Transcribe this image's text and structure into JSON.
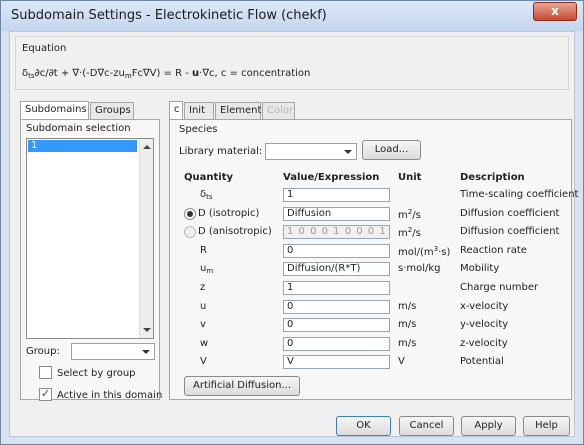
{
  "window": {
    "title": "Subdomain Settings - Electrokinetic Flow (chekf)",
    "close": "x"
  },
  "equation": {
    "label": "Equation",
    "text_html": "δ<span class=\"sub\">ts</span>∂c/∂t + ∇·(-D∇c-zu<span class=\"sub\">m</span>Fc∇V) = R - <b>u</b>·∇c, c = concentration"
  },
  "left_tabs": [
    "Subdomains",
    "Groups"
  ],
  "subdomain_selection": {
    "label": "Subdomain selection",
    "items": [
      "1"
    ]
  },
  "group": {
    "label": "Group:",
    "value": ""
  },
  "select_by_group": {
    "label": "Select by group",
    "checked": false
  },
  "active_in_domain": {
    "label": "Active in this domain",
    "checked": true
  },
  "right_tabs": [
    "c",
    "Init",
    "Element",
    "Color"
  ],
  "species": {
    "label": "Species",
    "library_label": "Library material:",
    "library_value": "",
    "load_button": "Load..."
  },
  "table": {
    "headers": [
      "Quantity",
      "Value/Expression",
      "Unit",
      "Description"
    ],
    "rows": [
      {
        "q_html": "δ<span class=\"sub\">ts</span>",
        "value": "1",
        "unit_html": "",
        "desc": "Time-scaling coefficient"
      },
      {
        "q_html": "D (isotropic)",
        "value": "Diffusion",
        "unit_html": "m<span class=\"sup\">2</span>/s",
        "desc": "Diffusion coefficient",
        "radio": "checked"
      },
      {
        "q_html": "D (anisotropic)",
        "value": "1 0 0 0 1 0 0 0 1",
        "unit_html": "m<span class=\"sup\">2</span>/s",
        "desc": "Diffusion coefficient",
        "radio": "unchecked",
        "disabled": true
      },
      {
        "q_html": "R",
        "value": "0",
        "unit_html": "mol/(m<span class=\"sup\">3</span>·s)",
        "desc": "Reaction rate"
      },
      {
        "q_html": "u<span class=\"sub\">m</span>",
        "value": "Diffusion/(R*T)",
        "unit_html": "s·mol/kg",
        "desc": "Mobility"
      },
      {
        "q_html": "z",
        "value": "1",
        "unit_html": "",
        "desc": "Charge number"
      },
      {
        "q_html": "u",
        "value": "0",
        "unit_html": "m/s",
        "desc": "x-velocity"
      },
      {
        "q_html": "v",
        "value": "0",
        "unit_html": "m/s",
        "desc": "y-velocity"
      },
      {
        "q_html": "w",
        "value": "0",
        "unit_html": "m/s",
        "desc": "z-velocity"
      },
      {
        "q_html": "V",
        "value": "V",
        "unit_html": "V",
        "desc": "Potential"
      }
    ]
  },
  "artificial_diffusion_button": "Artificial Diffusion...",
  "footer_buttons": [
    "OK",
    "Cancel",
    "Apply",
    "Help"
  ]
}
